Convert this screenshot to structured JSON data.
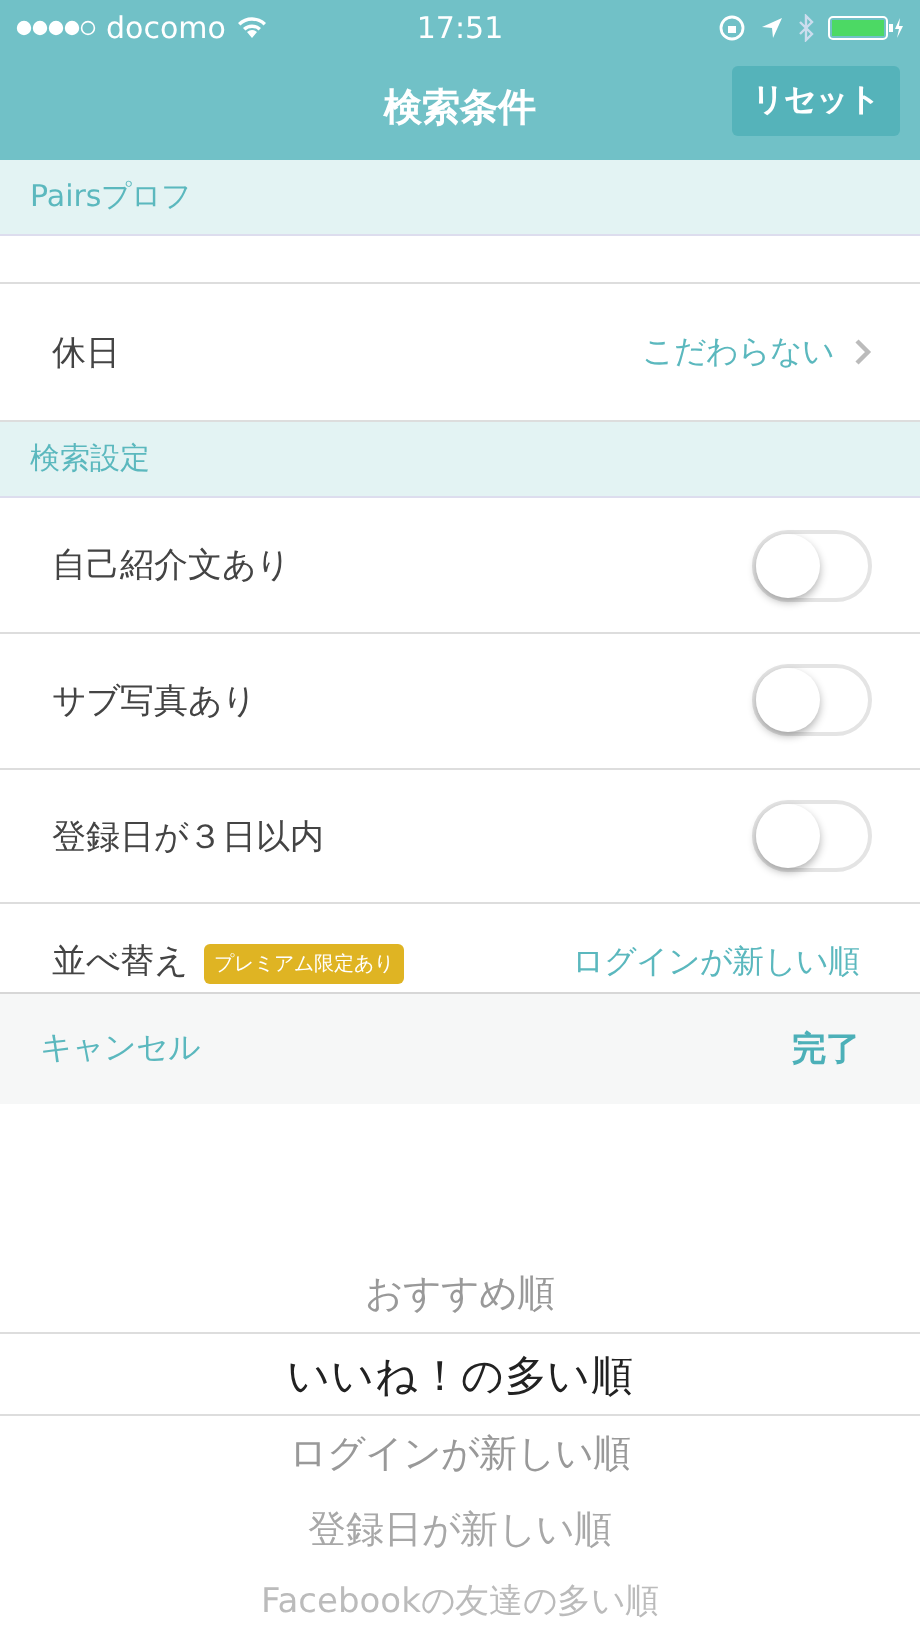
{
  "status_bar": {
    "carrier": "docomo",
    "time": "17:51"
  },
  "nav": {
    "title": "検索条件",
    "reset_button": "リセット"
  },
  "sections": [
    {
      "header": "Pairsプロフ",
      "rows": [
        {
          "kind": "blank"
        },
        {
          "kind": "value",
          "label": "休日",
          "value": "こだわらない"
        }
      ]
    },
    {
      "header": "検索設定",
      "rows": [
        {
          "kind": "toggle",
          "label": "自己紹介文あり",
          "on": false
        },
        {
          "kind": "toggle",
          "label": "サブ写真あり",
          "on": false
        },
        {
          "kind": "toggle",
          "label": "登録日が３日以内",
          "on": false
        },
        {
          "kind": "sort",
          "label": "並べ替え",
          "badge": "プレミアム限定あり",
          "value": "ログインが新しい順"
        }
      ]
    }
  ],
  "toolbar": {
    "cancel": "キャンセル",
    "done": "完了"
  },
  "picker": [
    {
      "label": "おすすめ順",
      "selected": false
    },
    {
      "label": "いいね！の多い順",
      "selected": true
    },
    {
      "label": "ログインが新しい順",
      "selected": false
    },
    {
      "label": "登録日が新しい順",
      "selected": false
    },
    {
      "label": "Facebookの友達の多い順",
      "selected": false
    }
  ]
}
